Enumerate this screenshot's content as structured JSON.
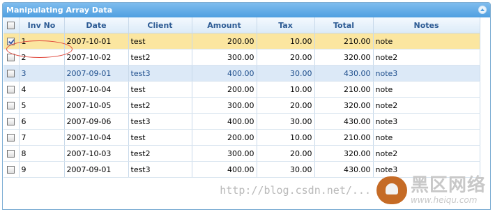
{
  "grid": {
    "title": "Manipulating Array Data",
    "columns": [
      "Inv No",
      "Date",
      "Client",
      "Amount",
      "Tax",
      "Total",
      "Notes"
    ],
    "rows": [
      {
        "inv": "1",
        "date": "2007-10-01",
        "client": "test",
        "amount": "200.00",
        "tax": "10.00",
        "total": "210.00",
        "notes": "note",
        "checked": true
      },
      {
        "inv": "2",
        "date": "2007-10-02",
        "client": "test2",
        "amount": "300.00",
        "tax": "20.00",
        "total": "320.00",
        "notes": "note2",
        "checked": false
      },
      {
        "inv": "3",
        "date": "2007-09-01",
        "client": "test3",
        "amount": "400.00",
        "tax": "30.00",
        "total": "430.00",
        "notes": "note3",
        "checked": false
      },
      {
        "inv": "4",
        "date": "2007-10-04",
        "client": "test",
        "amount": "200.00",
        "tax": "10.00",
        "total": "210.00",
        "notes": "note",
        "checked": false
      },
      {
        "inv": "5",
        "date": "2007-10-05",
        "client": "test2",
        "amount": "300.00",
        "tax": "20.00",
        "total": "320.00",
        "notes": "note2",
        "checked": false
      },
      {
        "inv": "6",
        "date": "2007-09-06",
        "client": "test3",
        "amount": "400.00",
        "tax": "30.00",
        "total": "430.00",
        "notes": "note3",
        "checked": false
      },
      {
        "inv": "7",
        "date": "2007-10-04",
        "client": "test",
        "amount": "200.00",
        "tax": "10.00",
        "total": "210.00",
        "notes": "note",
        "checked": false
      },
      {
        "inv": "8",
        "date": "2007-10-03",
        "client": "test2",
        "amount": "300.00",
        "tax": "20.00",
        "total": "320.00",
        "notes": "note2",
        "checked": false
      },
      {
        "inv": "9",
        "date": "2007-09-01",
        "client": "test3",
        "amount": "400.00",
        "tax": "30.00",
        "total": "430.00",
        "notes": "note3",
        "checked": false
      }
    ]
  },
  "watermark": {
    "url": "http://blog.csdn.net/...",
    "brand": "黑区网络",
    "site": "www.heiqu.com"
  },
  "colors": {
    "header_bg": "#4f9fe0",
    "selected_row": "#fbe6a0",
    "highlight_row": "#dce9f7",
    "annotation": "#e0463a"
  }
}
